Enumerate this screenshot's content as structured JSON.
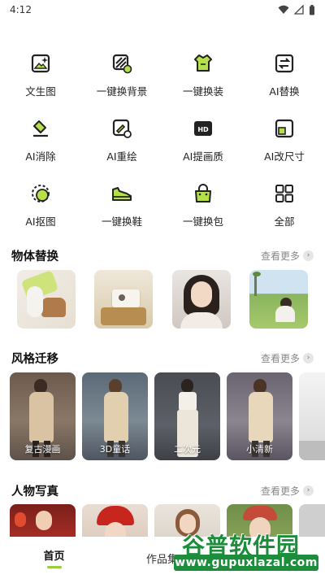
{
  "status": {
    "time": "4:12"
  },
  "tools": [
    {
      "label": "文生图",
      "icon": "image-sparkle-icon"
    },
    {
      "label": "一键换背景",
      "icon": "background-swap-icon"
    },
    {
      "label": "一键换装",
      "icon": "shirt-swap-icon"
    },
    {
      "label": "AI替换",
      "icon": "swap-arrows-icon"
    },
    {
      "label": "AI消除",
      "icon": "eraser-icon"
    },
    {
      "label": "AI重绘",
      "icon": "brush-redraw-icon"
    },
    {
      "label": "AI提画质",
      "icon": "hd-icon"
    },
    {
      "label": "AI改尺寸",
      "icon": "resize-icon"
    },
    {
      "label": "AI抠图",
      "icon": "cutout-circle-icon"
    },
    {
      "label": "一键换鞋",
      "icon": "shoe-icon"
    },
    {
      "label": "一键换包",
      "icon": "bag-icon"
    },
    {
      "label": "全部",
      "icon": "grid-all-icon"
    }
  ],
  "sections": {
    "object_replace": {
      "title": "物体替换",
      "more": "查看更多"
    },
    "style_transfer": {
      "title": "风格迁移",
      "more": "查看更多",
      "items": [
        {
          "caption": "复古漫画"
        },
        {
          "caption": "3D童话"
        },
        {
          "caption": "二次元"
        },
        {
          "caption": "小清新"
        }
      ]
    },
    "portrait": {
      "title": "人物写真",
      "more": "查看更多"
    }
  },
  "nav": {
    "home": "首页",
    "works": "作品集"
  },
  "watermark": {
    "title": "谷普软件园",
    "url": "www.gupuxlazal.com"
  },
  "colors": {
    "accent": "#9acd3c",
    "icon_accent": "#b5e04a",
    "watermark_green": "#1c8d3b"
  }
}
